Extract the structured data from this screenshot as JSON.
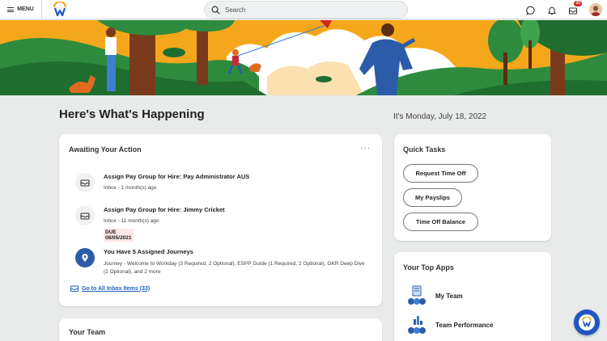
{
  "topbar": {
    "menu_label": "MENU",
    "search_placeholder": "Search",
    "inbox_badge": "20"
  },
  "page": {
    "title": "Here's What's Happening",
    "date": "It's Monday, July 18, 2022"
  },
  "awaiting": {
    "title": "Awaiting Your Action",
    "more": "···",
    "tasks": [
      {
        "title": "Assign Pay Group for Hire: Pay Administrator AUS",
        "sub": "Inbox - 1 month(s) ago"
      },
      {
        "title": "Assign Pay Group for Hire: Jimmy Cricket",
        "sub": "Inbox - 11 month(s) ago",
        "due": "DUE 08/05/2021"
      },
      {
        "title": "You Have 5 Assigned Journeys",
        "sub": "Journey - Welcome to Workday (3 Required, 2 Optional), ESPP Guide (1 Required, 2 Optional), OKR Deep Dive (2 Optional), and 2 more"
      }
    ],
    "inbox_link": "Go to All Inbox Items (33)"
  },
  "team": {
    "title": "Your Team"
  },
  "quick_tasks": {
    "title": "Quick Tasks",
    "buttons": [
      "Request Time Off",
      "My Payslips",
      "Time Off Balance"
    ]
  },
  "top_apps": {
    "title": "Your Top Apps",
    "apps": [
      "My Team",
      "Team Performance"
    ]
  },
  "colors": {
    "accent": "#1f56c2",
    "link": "#1f5fbf",
    "badge": "#d0271d",
    "sun": "#f5a71b",
    "grass": "#2e8b3e"
  }
}
